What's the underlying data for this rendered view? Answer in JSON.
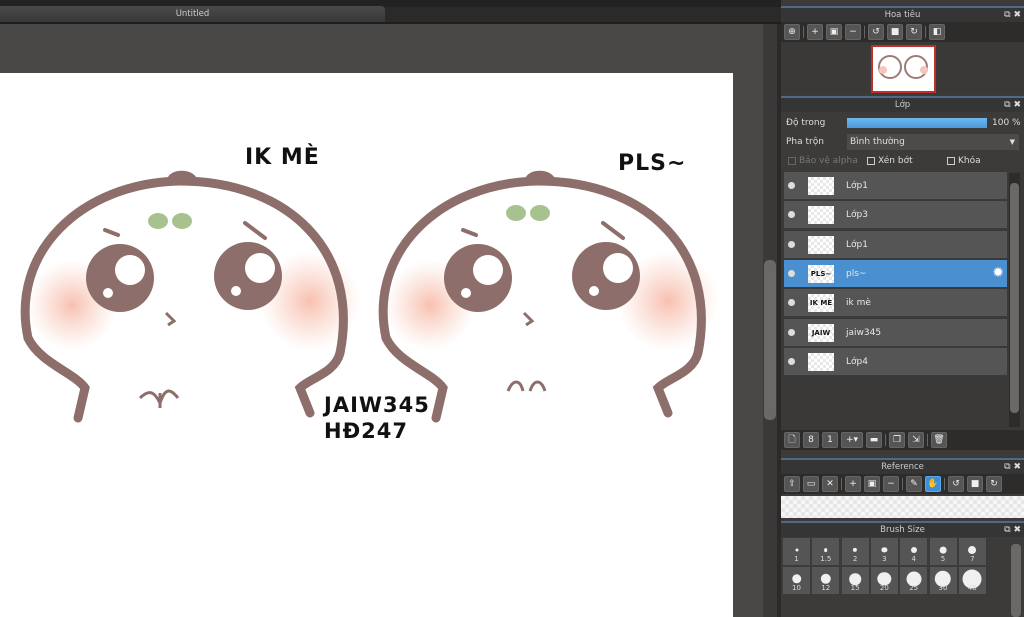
{
  "document": {
    "tab_title": "Untitled"
  },
  "canvas_text": {
    "left": "IK MÈ",
    "right": "PLS~",
    "center_line1": "JAIW345",
    "center_line2": "HĐ247"
  },
  "navigator": {
    "title": "Hoa tiêu"
  },
  "layers": {
    "title": "Lớp",
    "opacity_label": "Độ trong",
    "opacity_value": "100 %",
    "opacity_percent": 100,
    "blend_label": "Pha trộn",
    "blend_value": "Bình thường",
    "protect_alpha": "Bảo vệ alpha",
    "clip": "Xén bớt",
    "lock": "Khóa",
    "items": [
      {
        "name": "Lớp1",
        "thumb": ""
      },
      {
        "name": "Lớp3",
        "thumb": ""
      },
      {
        "name": "Lớp1",
        "thumb": ""
      },
      {
        "name": "pls~",
        "thumb": "PLS~",
        "selected": true
      },
      {
        "name": "ik mè",
        "thumb": "IK MÈ"
      },
      {
        "name": "jaiw345",
        "thumb": "JAIW"
      },
      {
        "name": "Lớp4",
        "thumb": ""
      }
    ]
  },
  "reference": {
    "title": "Reference"
  },
  "brush_size": {
    "title": "Brush Size",
    "sizes": [
      "1",
      "1.5",
      "2",
      "3",
      "4",
      "5",
      "7",
      "10",
      "12",
      "15",
      "20",
      "25",
      "30",
      "40"
    ]
  },
  "colors": {
    "accent": "#4a8fd0",
    "panel": "#3c3b3a",
    "workspace": "#4a4847"
  }
}
